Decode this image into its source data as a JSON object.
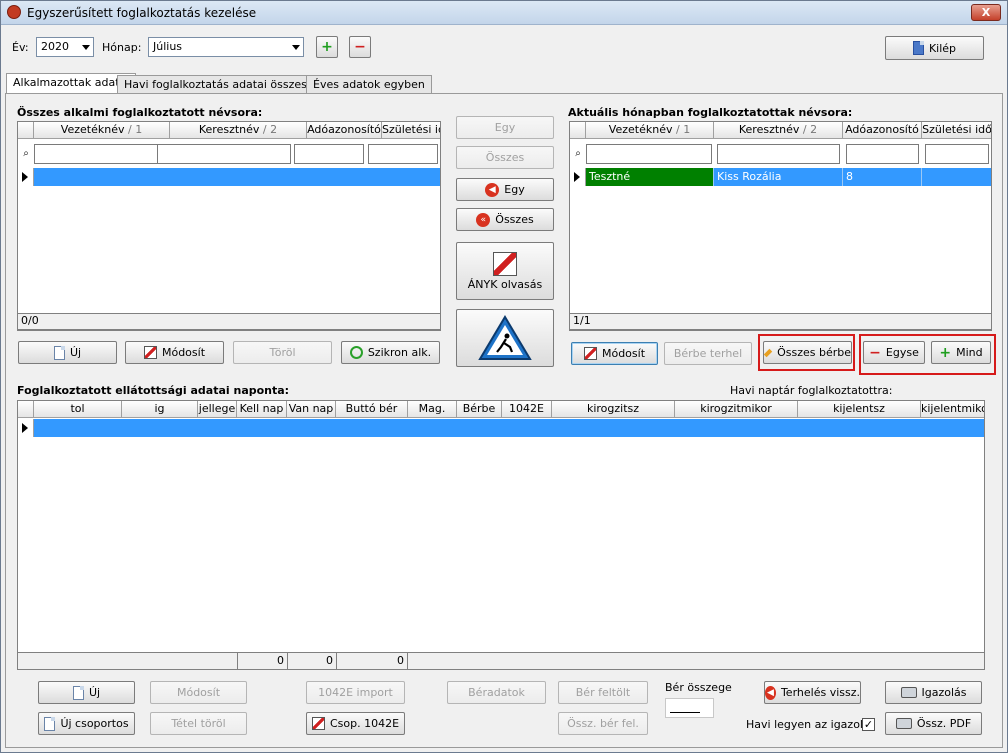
{
  "window": {
    "title": "Egyszerűsített foglalkoztatás kezelése",
    "close_label": "X"
  },
  "toolbar": {
    "year_label": "Év:",
    "year_value": "2020",
    "month_label": "Hónap:",
    "month_value": "Július",
    "add_label": "+",
    "remove_label": "−",
    "exit_label": "Kilép"
  },
  "tabs": [
    {
      "label": "Alkalmazottak adatai",
      "active": true
    },
    {
      "label": "Havi foglalkoztatás adatai összesítve",
      "active": false
    },
    {
      "label": "Éves adatok egyben",
      "active": false
    }
  ],
  "left": {
    "title": "Összes alkalmi foglalkoztatott névsora:",
    "columns": [
      "Vezetéknév",
      "1",
      "Keresztnév",
      "2",
      "Adóazonosító",
      "Születési idő"
    ],
    "counter": "0/0",
    "buttons": {
      "new": "Új",
      "edit": "Módosít",
      "delete": "Töröl",
      "sync": "Szikron alk."
    }
  },
  "middle": {
    "one_right": "Egy",
    "all_right": "Összes",
    "one_left": "Egy",
    "all_left": "Összes",
    "anyk": "ÁNYK olvasás"
  },
  "right": {
    "title": "Aktuális hónapban foglalkoztatottak névsora:",
    "columns": [
      "Vezetéknév",
      "1",
      "Keresztnév",
      "2",
      "Adóazonosító",
      "Születési idő"
    ],
    "rows": [
      {
        "last": "Tesztné",
        "first": "Kiss Rozália",
        "tax": "8",
        "birth": ""
      }
    ],
    "counter": "1/1",
    "buttons": {
      "edit": "Módosít",
      "lend": "Bérbe terhel",
      "all_lend": "Összes bérbe",
      "one_minus": "Egyse",
      "all_plus": "Mind"
    }
  },
  "bottom": {
    "title": "Foglalkoztatott ellátottsági adatai naponta:",
    "calendar_label": "Havi naptár foglalkoztatottra:",
    "columns": [
      "tol",
      "ig",
      "jellege",
      "Kell nap",
      "Van nap",
      "Buttó bér",
      "Mag.",
      "Bérbe",
      "1042E",
      "kirogzitsz",
      "kirogzitmikor",
      "kijelentsz",
      "kijelentmikor"
    ],
    "totals": [
      "0",
      "0",
      "0"
    ],
    "buttons": {
      "new": "Új",
      "group_new": "Új csoportos",
      "edit": "Módosít",
      "item_delete": "Tétel töröl",
      "import": "1042E import",
      "group_1042": "Csop. 1042E",
      "wage_data": "Béradatok",
      "wage_upload": "Bér feltölt",
      "sum_wage_upload": "Össz. bér fel.",
      "wage_sum_label": "Bér összege",
      "wage_sum_value": "",
      "charge_back": "Terhelés vissz.",
      "certificate": "Igazolás",
      "sum_pdf": "Össz. PDF",
      "monthly_cert_label": "Havi legyen az igazolás"
    }
  },
  "colors": {
    "selection": "#3399ff",
    "row_green": "#008000",
    "highlight_box": "#d61a1a"
  }
}
